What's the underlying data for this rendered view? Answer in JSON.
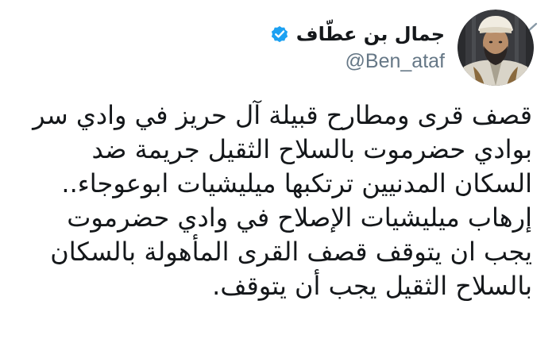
{
  "colors": {
    "text_primary": "#14171a",
    "text_secondary": "#657786",
    "verified_blue": "#1da1f2",
    "background": "#ffffff"
  },
  "author": {
    "display_name": "جمال بن عطّاف",
    "handle": "@Ben_ataf",
    "verified": true,
    "verified_icon": "verified-badge-icon",
    "avatar_icon": "profile-avatar"
  },
  "menu": {
    "icon": "chevron-down-icon"
  },
  "tweet": {
    "lines": [
      "قصف قرى ومطارح قبيلة آل حريز في وادي سر",
      "بوادي حضرموت بالسلاح الثقيل جريمة ضد",
      "السكان المدنيين ترتكبها ميليشيات ابوعوجاء..",
      "إرهاب ميليشيات الإصلاح في وادي حضرموت",
      "يجب ان يتوقف قصف القرى المأهولة بالسكان",
      "بالسلاح الثقيل يجب أن يتوقف."
    ]
  }
}
